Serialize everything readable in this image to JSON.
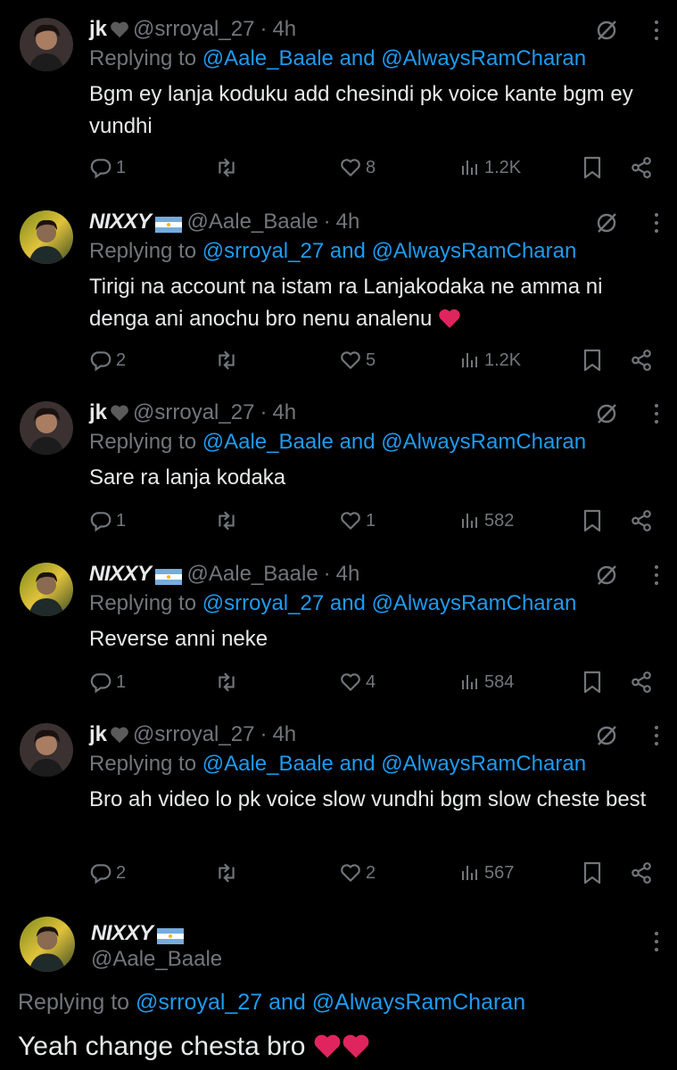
{
  "colors": {
    "background": "#000000",
    "text": "#e7e9ea",
    "muted": "#71767b",
    "link": "#1d9bf0",
    "heart": "#e0245e"
  },
  "tweets": [
    {
      "name": "jk",
      "badge": "black-heart",
      "handle": "@srroyal_27",
      "dot": "·",
      "time": "4h",
      "replying": "Replying to",
      "mention1": "@Aale_Baale",
      "and": "and",
      "mention2": "@AlwaysRamCharan",
      "text": "Bgm ey lanja koduku add chesindi pk voice kante bgm ey vundhi",
      "replies": "1",
      "retweets": "",
      "likes": "8",
      "views": "1.2K"
    },
    {
      "name": "NIXXY",
      "badge": "argentina-flag",
      "handle": "@Aale_Baale",
      "dot": "·",
      "time": "4h",
      "replying": "Replying to",
      "mention1": "@srroyal_27",
      "and": "and",
      "mention2": "@AlwaysRamCharan",
      "text": "Tirigi na account na istam ra Lanjakodaka ne amma ni denga ani anochu bro nenu analenu",
      "replies": "2",
      "retweets": "",
      "likes": "5",
      "views": "1.2K"
    },
    {
      "name": "jk",
      "badge": "black-heart",
      "handle": "@srroyal_27",
      "dot": "·",
      "time": "4h",
      "replying": "Replying to",
      "mention1": "@Aale_Baale",
      "and": "and",
      "mention2": "@AlwaysRamCharan",
      "text": "Sare ra lanja kodaka",
      "replies": "1",
      "retweets": "",
      "likes": "1",
      "views": "582"
    },
    {
      "name": "NIXXY",
      "badge": "argentina-flag",
      "handle": "@Aale_Baale",
      "dot": "·",
      "time": "4h",
      "replying": "Replying to",
      "mention1": "@srroyal_27",
      "and": "and",
      "mention2": "@AlwaysRamCharan",
      "text": "Reverse anni neke",
      "replies": "1",
      "retweets": "",
      "likes": "4",
      "views": "584"
    },
    {
      "name": "jk",
      "badge": "black-heart",
      "handle": "@srroyal_27",
      "dot": "·",
      "time": "4h",
      "replying": "Replying to",
      "mention1": "@Aale_Baale",
      "and": "and",
      "mention2": "@AlwaysRamCharan",
      "text": "Bro ah video lo pk voice slow vundhi bgm slow cheste best",
      "replies": "2",
      "retweets": "",
      "likes": "2",
      "views": "567"
    }
  ],
  "focused": {
    "name": "NIXXY",
    "badge": "argentina-flag",
    "handle": "@Aale_Baale",
    "replying": "Replying to",
    "mention1": "@srroyal_27",
    "and": "and",
    "mention2": "@AlwaysRamCharan",
    "text": "Yeah change chesta bro"
  }
}
